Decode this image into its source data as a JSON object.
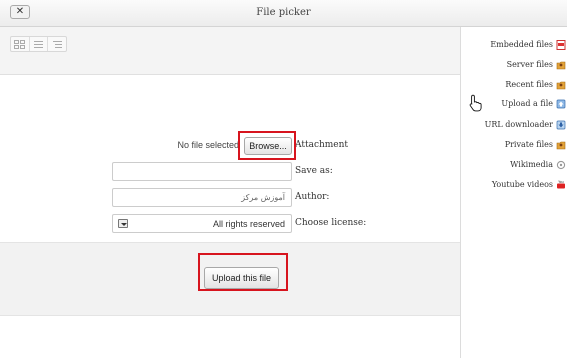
{
  "window": {
    "title": "File picker",
    "close_symbol": "✕"
  },
  "toolbar": {
    "view_icons": [
      "icon-view-icon",
      "list-view-icon",
      "tree-view-icon"
    ]
  },
  "form": {
    "attachment": {
      "status": "No file selected",
      "button": "Browse...",
      "label": "Attachment"
    },
    "save_as": {
      "label": "Save as:",
      "value": ""
    },
    "author": {
      "label": "Author:",
      "value": "آموزش مرکز"
    },
    "license": {
      "label": "Choose license:",
      "selected": "All rights reserved"
    },
    "upload_button": "Upload this file"
  },
  "sidebar": {
    "items": [
      {
        "label": "Embedded files",
        "icon": "pdf-file-icon"
      },
      {
        "label": "Server files",
        "icon": "server-folder-icon"
      },
      {
        "label": "Recent files",
        "icon": "recent-folder-icon"
      },
      {
        "label": "Upload a file",
        "icon": "upload-icon",
        "active": true
      },
      {
        "label": "URL downloader",
        "icon": "url-download-icon"
      },
      {
        "label": "Private files",
        "icon": "private-folder-icon"
      },
      {
        "label": "Wikimedia",
        "icon": "wikimedia-icon"
      },
      {
        "label": "Youtube videos",
        "icon": "youtube-icon"
      }
    ]
  },
  "colors": {
    "highlight": "#d7141e",
    "panel": "#f2f2f2",
    "accent_upload": "#e8f0fb"
  }
}
